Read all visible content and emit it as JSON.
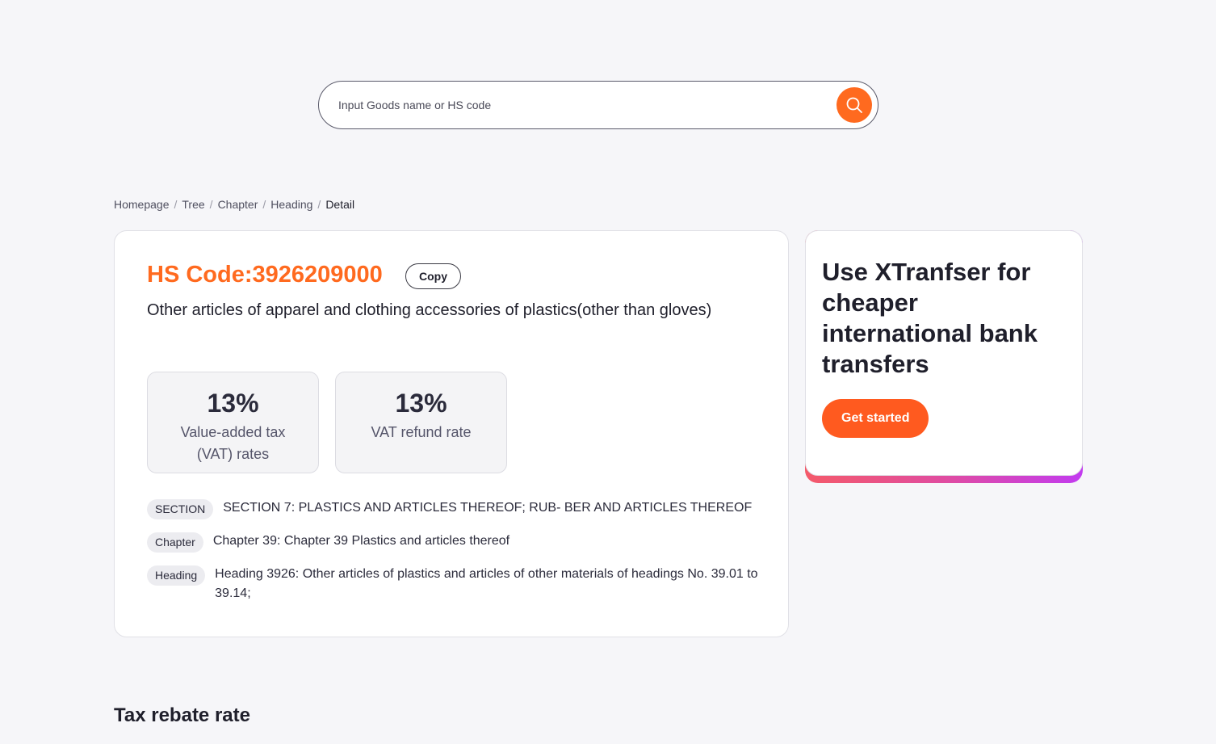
{
  "search": {
    "placeholder": "Input Goods name or HS code"
  },
  "breadcrumb": {
    "items": [
      "Homepage",
      "Tree",
      "Chapter",
      "Heading"
    ],
    "current": "Detail",
    "separator": "/"
  },
  "detail": {
    "hs_title": "HS Code:3926209000",
    "copy_label": "Copy",
    "description": "Other articles of apparel and clothing accessories of plastics(other than gloves)",
    "stats": [
      {
        "value": "13%",
        "label": "Value-added tax (VAT) rates"
      },
      {
        "value": "13%",
        "label": "VAT refund rate"
      }
    ],
    "info": [
      {
        "tag": "SECTION",
        "text": "SECTION 7: PLASTICS AND ARTICLES THEREOF; RUB- BER AND ARTICLES THEREOF"
      },
      {
        "tag": "Chapter",
        "text": "Chapter 39: Chapter 39 Plastics and articles thereof"
      },
      {
        "tag": "Heading",
        "text": "Heading 3926: Other articles of plastics and articles of other materials of headings No. 39.01 to 39.14;"
      }
    ]
  },
  "promo": {
    "heading": "Use XTranfser for cheaper international bank transfers",
    "button_label": "Get started"
  },
  "section": {
    "title": "Tax rebate rate"
  },
  "colors": {
    "accent": "#ff6a1f",
    "background": "#f6f6f9",
    "gradient_start": "#f45a6a",
    "gradient_end": "#c23bf0"
  },
  "icons": {
    "search_button": "search-icon"
  }
}
